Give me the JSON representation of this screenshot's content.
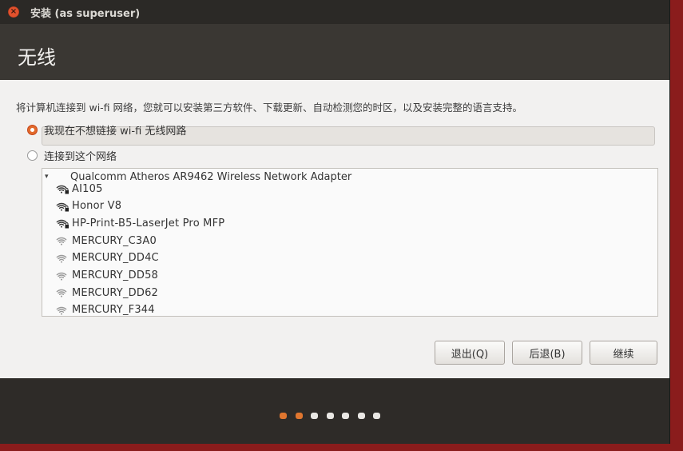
{
  "window": {
    "title": "安装 (as superuser)",
    "close_glyph": "×"
  },
  "header": {
    "title": "无线"
  },
  "intro_text": "将计算机连接到 wi-fi 网络，您就可以安装第三方软件、下载更新、自动检测您的时区，以及安装完整的语言支持。",
  "options": [
    {
      "label": "我现在不想链接 wi-fi 无线网路",
      "checked": true
    },
    {
      "label": "连接到这个网络",
      "checked": false
    }
  ],
  "adapter": {
    "name": "Qualcomm Atheros AR9462 Wireless Network Adapter",
    "expander": "▾"
  },
  "networks": [
    {
      "ssid": "AI105",
      "secured": true
    },
    {
      "ssid": "Honor V8",
      "secured": true
    },
    {
      "ssid": "HP-Print-B5-LaserJet Pro MFP",
      "secured": true
    },
    {
      "ssid": "MERCURY_C3A0",
      "secured": false
    },
    {
      "ssid": "MERCURY_DD4C",
      "secured": false
    },
    {
      "ssid": "MERCURY_DD58",
      "secured": false
    },
    {
      "ssid": "MERCURY_DD62",
      "secured": false
    },
    {
      "ssid": "MERCURY_F344",
      "secured": false
    }
  ],
  "buttons": {
    "quit": "退出(Q)",
    "back": "后退(B)",
    "continue": "继续"
  },
  "progress": {
    "total_steps": 7,
    "completed_steps": 2
  },
  "colors": {
    "accent": "#e26a2c",
    "dot_active": "#e0762f",
    "dot_inactive": "#e9e7e4",
    "header_bg": "#3a3733",
    "content_bg": "#f2f1f0"
  }
}
